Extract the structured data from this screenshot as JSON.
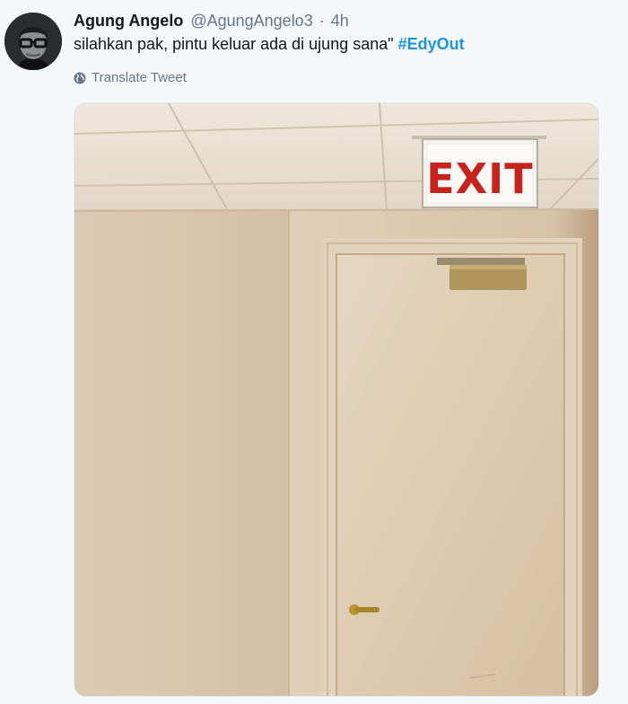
{
  "tweet": {
    "author_name": "Agung Angelo",
    "author_handle": "@AgungAngelo3",
    "separator": "·",
    "time": "4h",
    "text": "silahkan pak, pintu keluar ada di ujung sana\" ",
    "hashtag": "#EdyOut",
    "translate_label": "Translate Tweet",
    "translate_icon": "globe-icon",
    "media": {
      "sign_text": "EXIT",
      "sign_color": "#c8221e"
    }
  },
  "colors": {
    "background": "#f5f8fa",
    "text": "#14171a",
    "secondary": "#657786",
    "link": "#1b95e0"
  }
}
